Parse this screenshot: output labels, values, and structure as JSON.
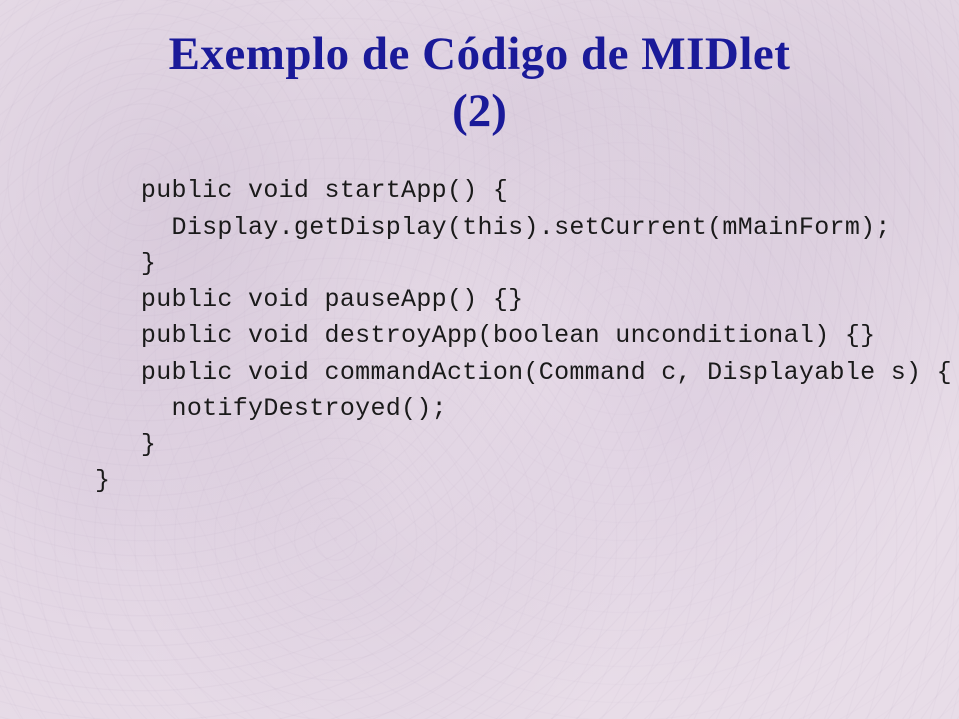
{
  "title": {
    "line1": "Exemplo de Código de MIDlet",
    "line2": "(2)"
  },
  "code": {
    "lines": [
      "   public void startApp() {",
      "     Display.getDisplay(this).setCurrent(mMainForm);",
      "   }",
      "   public void pauseApp() {}",
      "",
      "   public void destroyApp(boolean unconditional) {}",
      "",
      "   public void commandAction(Command c, Displayable s) {",
      "     notifyDestroyed();",
      "   }",
      "}"
    ]
  }
}
